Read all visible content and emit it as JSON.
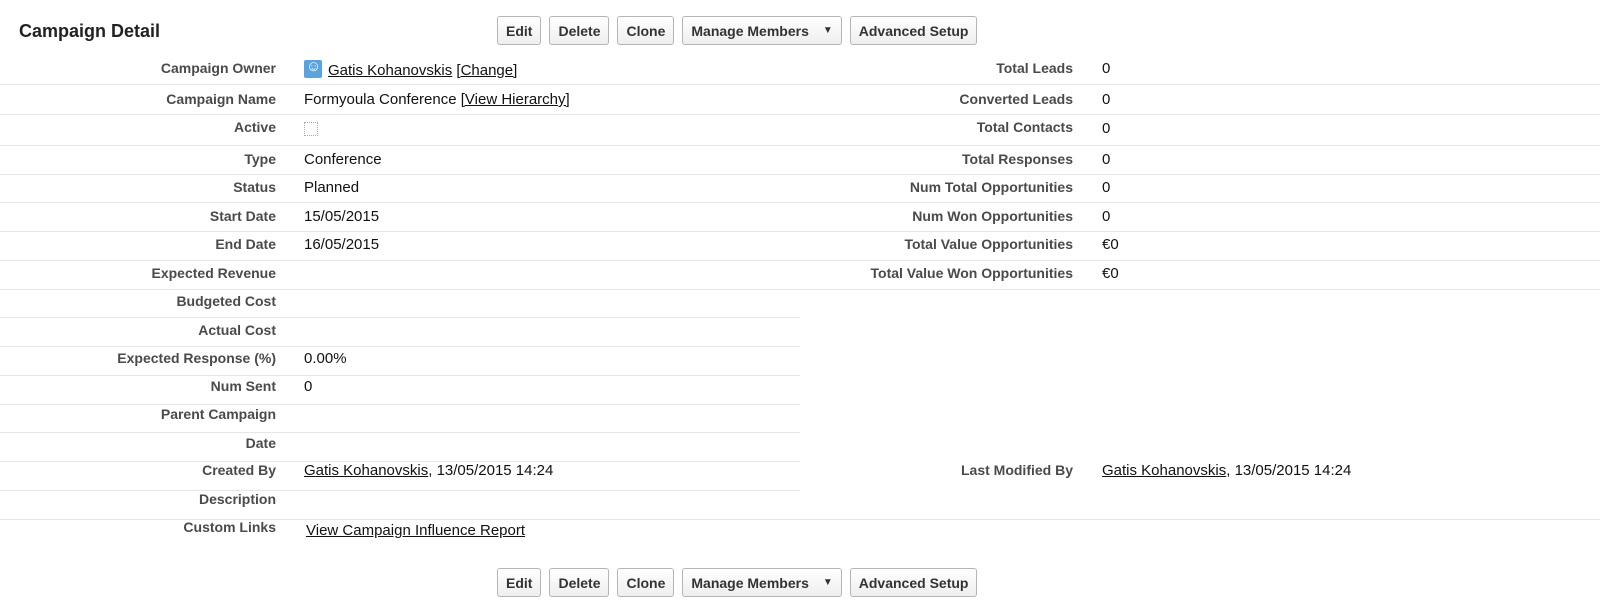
{
  "title": "Campaign Detail",
  "buttons": {
    "edit": "Edit",
    "delete": "Delete",
    "clone": "Clone",
    "manage_members": "Manage Members",
    "advanced_setup": "Advanced Setup"
  },
  "left_fields": {
    "campaign_owner": {
      "label": "Campaign Owner",
      "value": "Gatis Kohanovskis",
      "action": "[Change]"
    },
    "campaign_name": {
      "label": "Campaign Name",
      "value": "Formyoula Conference",
      "action": "[View Hierarchy]"
    },
    "active": {
      "label": "Active",
      "checked": false
    },
    "type": {
      "label": "Type",
      "value": "Conference"
    },
    "status": {
      "label": "Status",
      "value": "Planned"
    },
    "start_date": {
      "label": "Start Date",
      "value": "15/05/2015"
    },
    "end_date": {
      "label": "End Date",
      "value": "16/05/2015"
    },
    "expected_revenue": {
      "label": "Expected Revenue",
      "value": ""
    },
    "budgeted_cost": {
      "label": "Budgeted Cost",
      "value": ""
    },
    "actual_cost": {
      "label": "Actual Cost",
      "value": ""
    },
    "expected_response": {
      "label": "Expected Response (%)",
      "value": "0.00%"
    },
    "num_sent": {
      "label": "Num Sent",
      "value": "0"
    },
    "parent_campaign": {
      "label": "Parent Campaign",
      "value": ""
    },
    "date": {
      "label": "Date",
      "value": ""
    },
    "created_by": {
      "label": "Created By",
      "user": "Gatis Kohanovskis",
      "timestamp": ", 13/05/2015 14:24"
    },
    "description": {
      "label": "Description",
      "value": ""
    },
    "custom_links": {
      "label": "Custom Links",
      "link": "View Campaign Influence Report"
    }
  },
  "right_fields": {
    "total_leads": {
      "label": "Total Leads",
      "value": "0"
    },
    "converted_leads": {
      "label": "Converted Leads",
      "value": "0"
    },
    "total_contacts": {
      "label": "Total Contacts",
      "value": "0"
    },
    "total_responses": {
      "label": "Total Responses",
      "value": "0"
    },
    "num_total_opps": {
      "label": "Num Total Opportunities",
      "value": "0"
    },
    "num_won_opps": {
      "label": "Num Won Opportunities",
      "value": "0"
    },
    "total_value_opps": {
      "label": "Total Value Opportunities",
      "value": "€0"
    },
    "total_value_won_opps": {
      "label": "Total Value Won Opportunities",
      "value": "€0"
    },
    "last_modified_by": {
      "label": "Last Modified By",
      "user": "Gatis Kohanovskis",
      "timestamp": ", 13/05/2015 14:24"
    }
  }
}
